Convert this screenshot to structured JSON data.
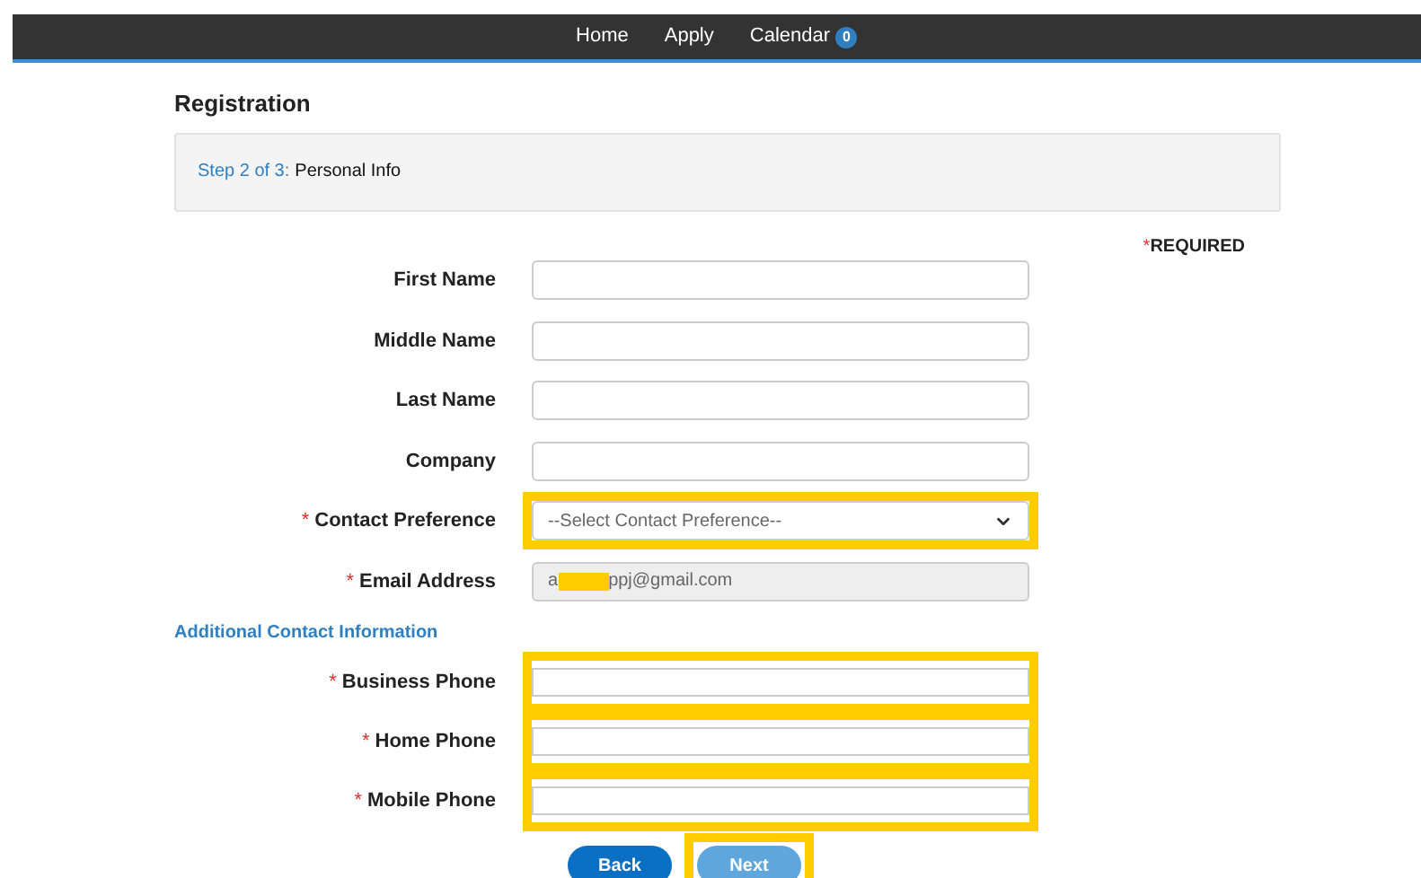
{
  "nav": [
    {
      "label": "Home"
    },
    {
      "label": "Apply"
    },
    {
      "label": "Calendar",
      "badge": "0"
    }
  ],
  "page_title": "Registration",
  "step": {
    "progress": "Step 2 of 3:",
    "name": "Personal Info"
  },
  "required_legend": {
    "marker": "*",
    "label": "REQUIRED"
  },
  "fields": [
    {
      "kind": "text",
      "label": "First Name",
      "highlighted": false
    },
    {
      "kind": "text",
      "label": "Middle Name",
      "highlighted": false
    },
    {
      "kind": "text",
      "label": "Last Name",
      "highlighted": false
    },
    {
      "kind": "text",
      "label": "Company",
      "highlighted": false
    },
    {
      "kind": "select",
      "marker": "*",
      "label": "Contact Preference",
      "placeholder": "--Select Contact Preference--",
      "highlighted": true
    },
    {
      "kind": "email",
      "marker": "*",
      "label": "Email Address",
      "value_start": "a",
      "value_end": "ppj@gmail.com",
      "redacted": true,
      "disabled": true,
      "highlighted": false
    }
  ],
  "section_title": "Additional Contact Information",
  "phones": [
    {
      "marker": "*",
      "label": "Business Phone",
      "highlighted": true
    },
    {
      "marker": "*",
      "label": "Home Phone",
      "highlighted": true
    },
    {
      "marker": "*",
      "label": "Mobile Phone",
      "highlighted": true
    }
  ],
  "buttons": [
    {
      "label": "Back",
      "disabled": false,
      "highlighted": false
    },
    {
      "label": "Next",
      "disabled": true,
      "highlighted": true
    }
  ]
}
